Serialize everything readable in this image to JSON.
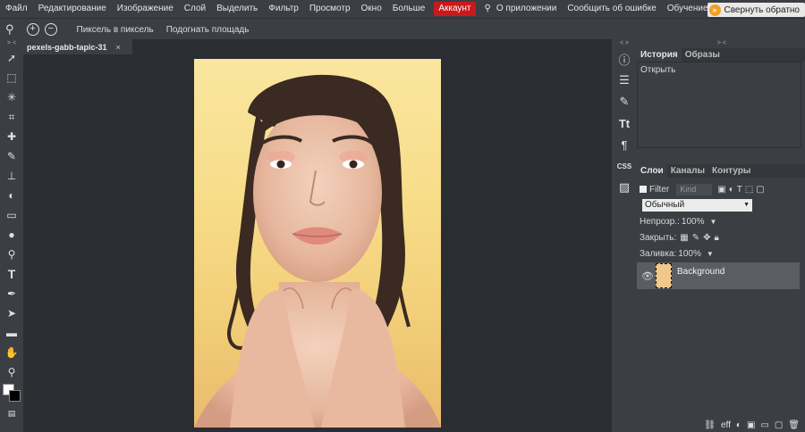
{
  "menu": {
    "items": [
      "Файл",
      "Редактирование",
      "Изображение",
      "Слой",
      "Выделить",
      "Фильтр",
      "Просмотр",
      "Окно",
      "Больше"
    ],
    "account": "Аккаунт",
    "extra": [
      "О приложении",
      "Сообщить об ошибке",
      "Обучение"
    ],
    "collapse_label": "Свернуть обратно"
  },
  "options": {
    "pixel_btn": "Пиксель в пиксель",
    "fit_btn": "Подогнать площадь"
  },
  "document": {
    "tab_name": "pexels-gabb-tapic-31",
    "close": "×"
  },
  "history": {
    "tabs": [
      "История",
      "Образы"
    ],
    "items": [
      "Открыть"
    ]
  },
  "layers": {
    "tabs": [
      "Слои",
      "Каналы",
      "Контуры"
    ],
    "filter_label": "Filter",
    "kind_label": "Kind",
    "blend_mode": "Обычный",
    "opacity_label": "Непрозр.:",
    "opacity_value": "100%",
    "lock_label": "Закрыть:",
    "fill_label": "Заливка:",
    "fill_value": "100%",
    "layer_name": "Background",
    "bottom_icons": [
      "link-icon",
      "eff",
      "adjust-icon",
      "mask-icon",
      "folder-icon",
      "new-layer-icon",
      "trash-icon"
    ]
  },
  "colors": {
    "accent_account": "#c8191c",
    "panel_bg": "#3b3e43",
    "workspace_bg": "#2a2d31"
  }
}
